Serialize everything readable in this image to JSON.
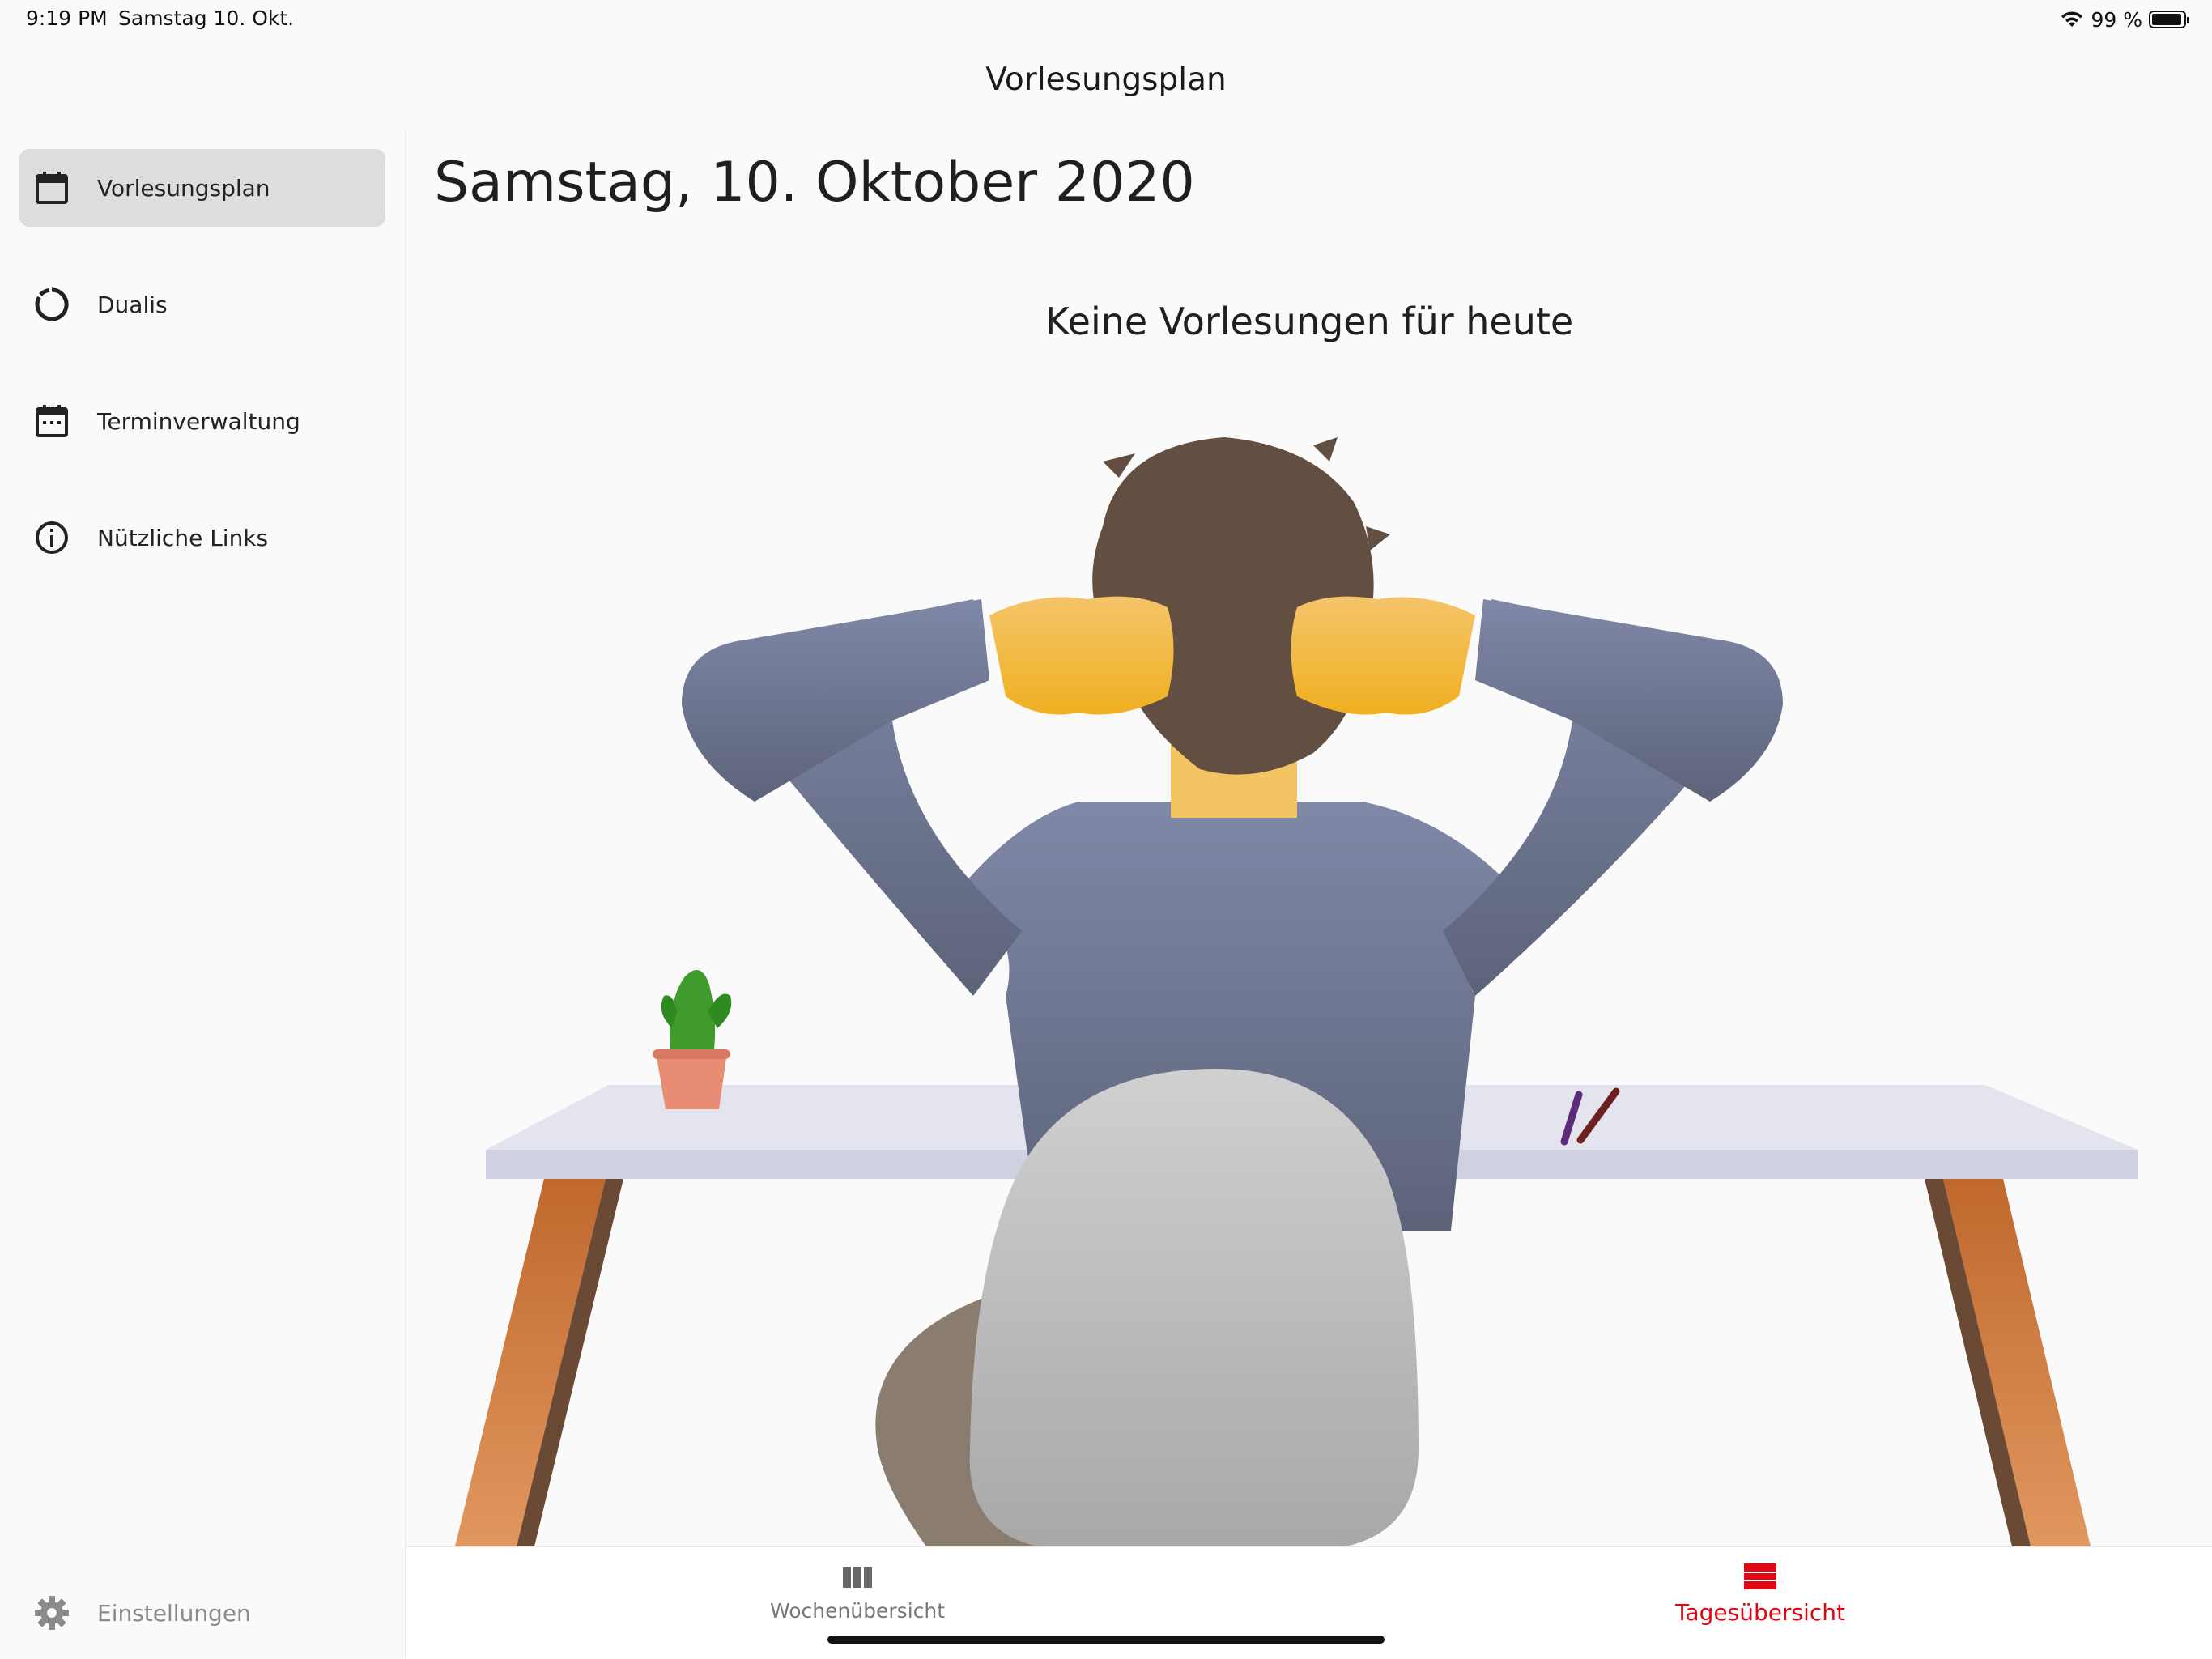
{
  "status_bar": {
    "time": "9:19 PM",
    "date": "Samstag 10. Okt.",
    "battery_text": "99 %",
    "icons": [
      "wifi-icon",
      "battery-icon"
    ]
  },
  "app_bar": {
    "title": "Vorlesungsplan"
  },
  "sidebar": {
    "items": [
      {
        "label": "Vorlesungsplan",
        "icon": "calendar-icon",
        "selected": true
      },
      {
        "label": "Dualis",
        "icon": "loading-circle-icon",
        "selected": false
      },
      {
        "label": "Terminverwaltung",
        "icon": "calendar-dots-icon",
        "selected": false
      },
      {
        "label": "Nützliche Links",
        "icon": "info-icon",
        "selected": false
      }
    ],
    "settings": {
      "label": "Einstellungen",
      "icon": "gear-icon"
    }
  },
  "main": {
    "date_heading": "Samstag, 10. Oktober 2020",
    "empty_message": "Keine Vorlesungen für heute",
    "illustration": "person-relaxing-at-desk-illustration"
  },
  "bottom_nav": {
    "tabs": [
      {
        "label": "Wochenübersicht",
        "icon": "week-columns-icon",
        "active": false
      },
      {
        "label": "Tagesübersicht",
        "icon": "day-rows-icon",
        "active": true
      }
    ]
  },
  "colors": {
    "accent": "#e30613",
    "selected_background": "#dddddd",
    "background": "#fafafa"
  }
}
